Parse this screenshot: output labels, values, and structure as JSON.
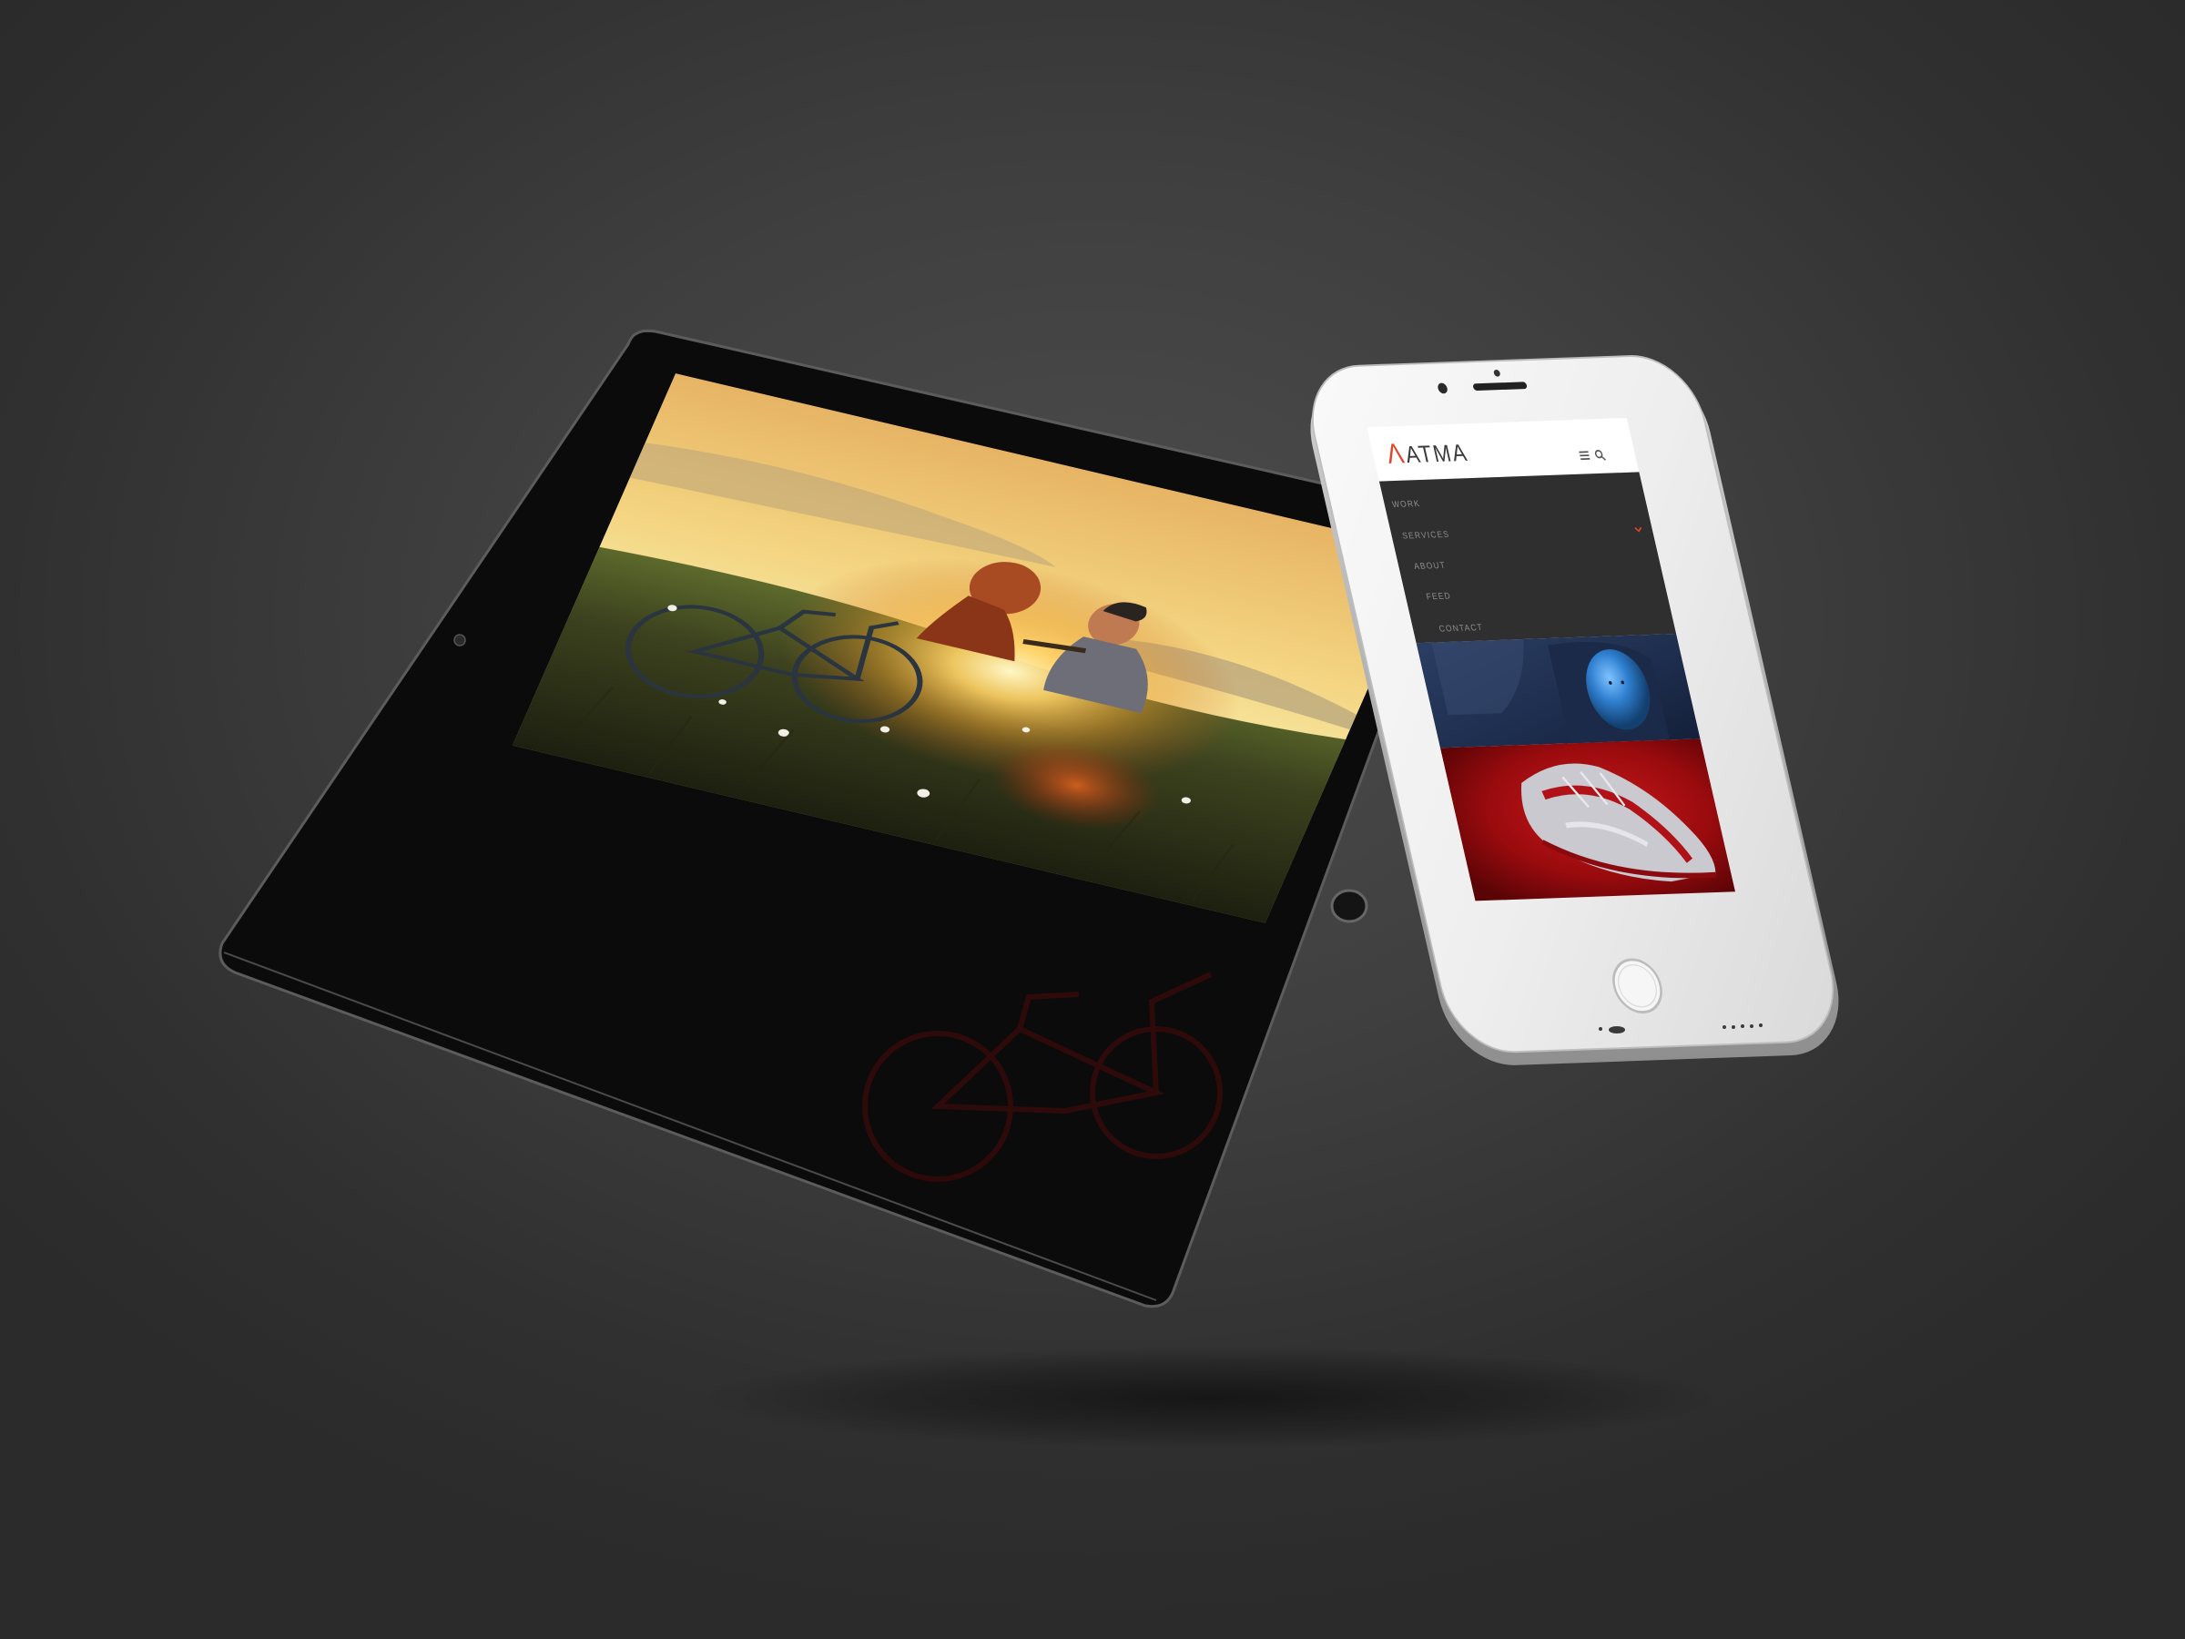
{
  "phone": {
    "logo": {
      "mark": "Λ",
      "text": "ATMA"
    },
    "header": {
      "menu_icon": "hamburger-icon",
      "search_icon": "search-icon"
    },
    "nav": {
      "items": [
        {
          "label": "WORK"
        },
        {
          "label": "SERVICES"
        },
        {
          "label": "ABOUT"
        },
        {
          "label": "FEED"
        },
        {
          "label": "CONTACT"
        }
      ]
    }
  },
  "colors": {
    "background": "#3f3f3f",
    "logo_accent": "#e2452c",
    "phone_menu_bg": "#2f2f2f",
    "phone_body": "#f2f2f2",
    "shoe_bg": "#a80d10",
    "nav_text": "#8e8e8e"
  }
}
